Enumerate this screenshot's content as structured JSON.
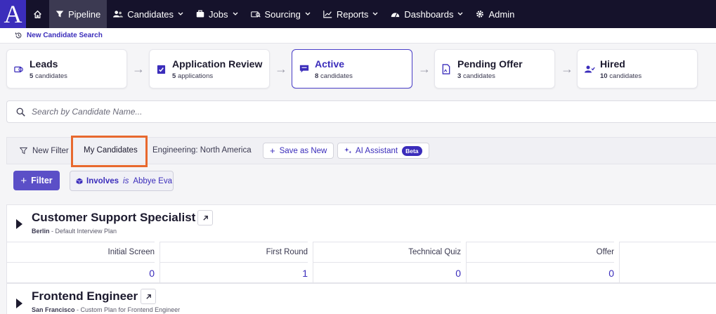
{
  "nav": {
    "logo": "A",
    "items": [
      {
        "label": "Pipeline",
        "active": true
      },
      {
        "label": "Candidates"
      },
      {
        "label": "Jobs"
      },
      {
        "label": "Sourcing"
      },
      {
        "label": "Reports"
      },
      {
        "label": "Dashboards"
      },
      {
        "label": "Admin"
      }
    ]
  },
  "subbar": {
    "link": "New Candidate Search"
  },
  "stages": [
    {
      "title": "Leads",
      "count": "5",
      "unit": "candidates",
      "icon": "leads-icon"
    },
    {
      "title": "Application Review",
      "count": "5",
      "unit": "applications",
      "icon": "clipboard-check-icon"
    },
    {
      "title": "Active",
      "count": "8",
      "unit": "candidates",
      "icon": "chat-icon",
      "active": true
    },
    {
      "title": "Pending Offer",
      "count": "3",
      "unit": "candidates",
      "icon": "document-sign-icon"
    },
    {
      "title": "Hired",
      "count": "10",
      "unit": "candidates",
      "icon": "user-check-icon"
    }
  ],
  "search": {
    "placeholder": "Search by Candidate Name..."
  },
  "filterbar": {
    "new_filter": "New Filter",
    "my_candidates": "My Candidates",
    "engineering": "Engineering: North America",
    "save_as_new": "Save as New",
    "ai_assistant": "AI Assistant",
    "beta": "Beta"
  },
  "filters": {
    "button": "Filter",
    "chip": {
      "key": "Involves",
      "op": "is",
      "value": "Abbye Eva"
    }
  },
  "jobs": [
    {
      "title": "Customer Support Specialist",
      "location": "Berlin",
      "plan": "Default Interview Plan",
      "stages": [
        {
          "name": "Initial Screen",
          "value": "0"
        },
        {
          "name": "First Round",
          "value": "1"
        },
        {
          "name": "Technical Quiz",
          "value": "0"
        },
        {
          "name": "Offer",
          "value": "0"
        }
      ]
    },
    {
      "title": "Frontend Engineer",
      "location": "San Francisco",
      "plan": "Custom Plan for Frontend Engineer"
    }
  ],
  "colors": {
    "accent": "#3b2dbb",
    "nav_bg": "#15122b",
    "highlight": "#e8692e"
  }
}
